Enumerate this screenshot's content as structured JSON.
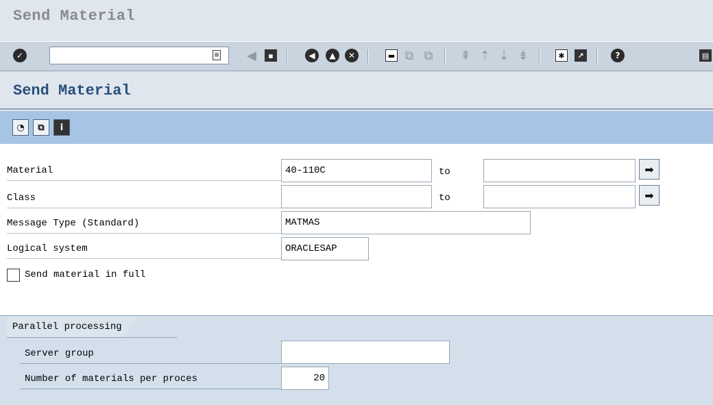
{
  "window": {
    "title": "Send Material"
  },
  "toolbar": {
    "command_field_value": "",
    "icons": [
      "enter-icon",
      "back-icon",
      "save-icon",
      "back-nav-icon",
      "exit-icon",
      "cancel-icon",
      "print-icon",
      "find-icon",
      "find-next-icon",
      "first-page-icon",
      "previous-page-icon",
      "next-page-icon",
      "last-page-icon",
      "new-session-icon",
      "shortcut-icon",
      "help-icon",
      "layout-menu-icon"
    ]
  },
  "screen": {
    "title": "Send Material"
  },
  "app_toolbar": {
    "buttons": [
      "execute-icon",
      "get-variant-icon",
      "information-icon"
    ]
  },
  "form": {
    "material": {
      "label": "Material",
      "from": "40-110C",
      "to_label": "to",
      "to": ""
    },
    "class": {
      "label": "Class",
      "from": "",
      "to_label": "to",
      "to": ""
    },
    "message_type": {
      "label": "Message Type (Standard)",
      "value": "MATMAS"
    },
    "logical_system": {
      "label": "Logical system",
      "value": "ORACLESAP"
    },
    "send_full": {
      "label": "Send material in full",
      "checked": false
    }
  },
  "parallel": {
    "title": "Parallel processing",
    "server_group": {
      "label": "Server group",
      "value": ""
    },
    "materials_per_process": {
      "label": "Number of materials per proces",
      "value": "20"
    }
  }
}
